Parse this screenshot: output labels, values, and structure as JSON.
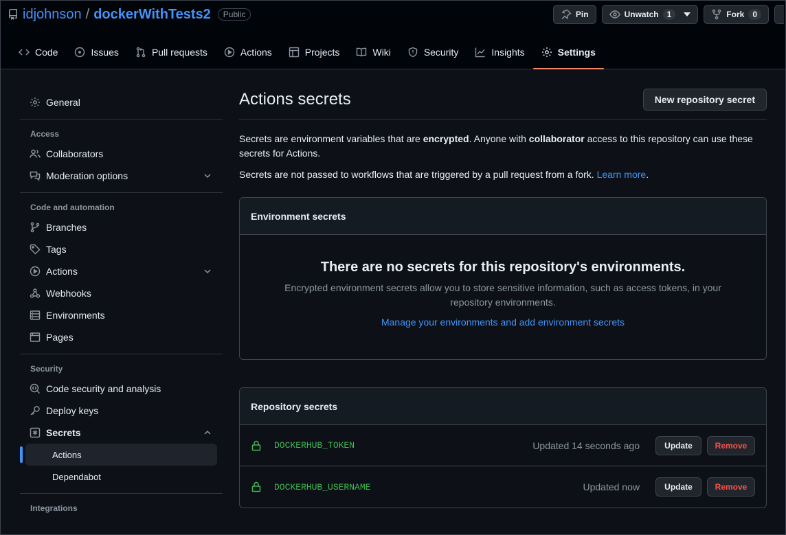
{
  "header": {
    "owner": "idjohnson",
    "separator": "/",
    "repo": "dockerWithTests2",
    "visibility": "Public",
    "pin_label": "Pin",
    "watch_label": "Unwatch",
    "watch_count": "1",
    "fork_label": "Fork",
    "fork_count": "0"
  },
  "tabs": [
    {
      "label": "Code",
      "icon": "code-icon"
    },
    {
      "label": "Issues",
      "icon": "issue-icon"
    },
    {
      "label": "Pull requests",
      "icon": "pull-request-icon"
    },
    {
      "label": "Actions",
      "icon": "play-icon"
    },
    {
      "label": "Projects",
      "icon": "table-icon"
    },
    {
      "label": "Wiki",
      "icon": "book-icon"
    },
    {
      "label": "Security",
      "icon": "shield-icon"
    },
    {
      "label": "Insights",
      "icon": "graph-icon"
    },
    {
      "label": "Settings",
      "icon": "gear-icon",
      "active": true
    }
  ],
  "sidebar": {
    "general": "General",
    "access_heading": "Access",
    "collaborators": "Collaborators",
    "moderation": "Moderation options",
    "code_automation_heading": "Code and automation",
    "branches": "Branches",
    "tags": "Tags",
    "actions": "Actions",
    "webhooks": "Webhooks",
    "environments": "Environments",
    "pages": "Pages",
    "security_heading": "Security",
    "code_security": "Code security and analysis",
    "deploy_keys": "Deploy keys",
    "secrets": "Secrets",
    "secrets_actions": "Actions",
    "secrets_dependabot": "Dependabot",
    "integrations_heading": "Integrations"
  },
  "main": {
    "title": "Actions secrets",
    "new_secret_button": "New repository secret",
    "intro_1a": "Secrets are environment variables that are ",
    "intro_1b": "encrypted",
    "intro_1c": ". Anyone with ",
    "intro_1d": "collaborator",
    "intro_1e": " access to this repository can use these secrets for Actions.",
    "intro_2": "Secrets are not passed to workflows that are triggered by a pull request from a fork. ",
    "learn_more": "Learn more",
    "intro_2_end": "."
  },
  "env_secrets": {
    "heading": "Environment secrets",
    "blank_title": "There are no secrets for this repository's environments.",
    "blank_desc": "Encrypted environment secrets allow you to store sensitive information, such as access tokens, in your repository environments.",
    "blank_link": "Manage your environments and add environment secrets"
  },
  "repo_secrets": {
    "heading": "Repository secrets",
    "items": [
      {
        "name": "DOCKERHUB_TOKEN",
        "updated": "Updated 14 seconds ago",
        "update_label": "Update",
        "remove_label": "Remove"
      },
      {
        "name": "DOCKERHUB_USERNAME",
        "updated": "Updated now",
        "update_label": "Update",
        "remove_label": "Remove"
      }
    ]
  },
  "colors": {
    "background": "#0d1117",
    "link": "#4493f8",
    "secret_green": "#3fb950",
    "danger": "#f85149",
    "active_tab_underline": "#f78166"
  }
}
